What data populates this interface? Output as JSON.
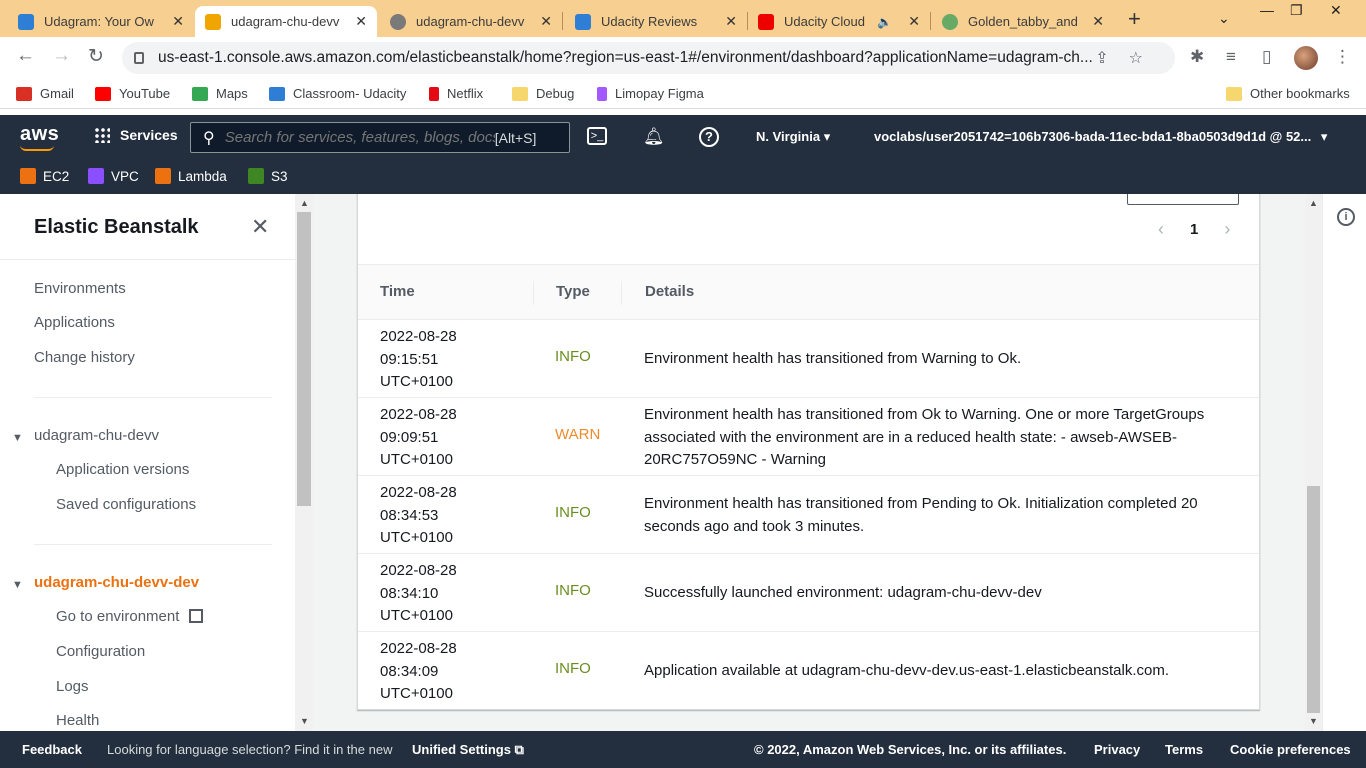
{
  "browser": {
    "tabs": [
      {
        "title": "Udagram: Your Ow",
        "color": "#2e7ed6",
        "active": false
      },
      {
        "title": "udagram-chu-devv",
        "color": "#f0a500",
        "active": true
      },
      {
        "title": "udagram-chu-devv",
        "color": "#7a7a7a",
        "active": false
      },
      {
        "title": "Udacity Reviews",
        "color": "#2e7ed6",
        "active": false
      },
      {
        "title": "Udacity Cloud",
        "color": "#e00",
        "active": false
      },
      {
        "title": "Golden_tabby_and",
        "color": "#6a6",
        "active": false
      }
    ],
    "url": "us-east-1.console.aws.amazon.com/elasticbeanstalk/home?region=us-east-1#/environment/dashboard?applicationName=udagram-ch...",
    "bookmarks": [
      {
        "label": "Gmail",
        "color": "#d93025"
      },
      {
        "label": "YouTube",
        "color": "#ff0000"
      },
      {
        "label": "Maps",
        "color": "#34a853"
      },
      {
        "label": "Classroom- Udacity",
        "color": "#2e7ed6"
      },
      {
        "label": "Netflix",
        "color": "#e50914"
      },
      {
        "label": "Debug",
        "color": "#f5d76e"
      },
      {
        "label": "Limopay Figma",
        "color": "#a259ff"
      }
    ],
    "other_bookmarks": "Other bookmarks"
  },
  "aws": {
    "logo": "aws",
    "services": "Services",
    "search_placeholder": "Search for services, features, blogs, docs, and more",
    "search_shortcut": "[Alt+S]",
    "region": "N. Virginia",
    "account": "voclabs/user2051742=106b7306-bada-11ec-bda1-8ba0503d9d1d @ 52...",
    "favorites": [
      {
        "label": "EC2",
        "color": "#ec7211"
      },
      {
        "label": "VPC",
        "color": "#8c4fff"
      },
      {
        "label": "Lambda",
        "color": "#ec7211"
      },
      {
        "label": "S3",
        "color": "#3f8624"
      }
    ]
  },
  "sidebar": {
    "title": "Elastic Beanstalk",
    "top_links": [
      "Environments",
      "Applications",
      "Change history"
    ],
    "app_name": "udagram-chu-devv",
    "app_links": [
      "Application versions",
      "Saved configurations"
    ],
    "env_name": "udagram-chu-devv-dev",
    "env_links": [
      "Go to environment",
      "Configuration",
      "Logs",
      "Health"
    ]
  },
  "events": {
    "page": "1",
    "columns": [
      "Time",
      "Type",
      "Details"
    ],
    "rows": [
      {
        "date": "2022-08-28",
        "time": "09:15:51",
        "tz": "UTC+0100",
        "type": "INFO",
        "details": "Environment health has transitioned from Warning to Ok."
      },
      {
        "date": "2022-08-28",
        "time": "09:09:51",
        "tz": "UTC+0100",
        "type": "WARN",
        "details": "Environment health has transitioned from Ok to Warning. One or more TargetGroups associated with the environment are in a reduced health state: - awseb-AWSEB-20RC757O59NC - Warning"
      },
      {
        "date": "2022-08-28",
        "time": "08:34:53",
        "tz": "UTC+0100",
        "type": "INFO",
        "details": "Environment health has transitioned from Pending to Ok. Initialization completed 20 seconds ago and took 3 minutes."
      },
      {
        "date": "2022-08-28",
        "time": "08:34:10",
        "tz": "UTC+0100",
        "type": "INFO",
        "details": "Successfully launched environment: udagram-chu-devv-dev"
      },
      {
        "date": "2022-08-28",
        "time": "08:34:09",
        "tz": "UTC+0100",
        "type": "INFO",
        "details": "Application available at udagram-chu-devv-dev.us-east-1.elasticbeanstalk.com."
      }
    ]
  },
  "footer": {
    "feedback": "Feedback",
    "language_text": "Looking for language selection? Find it in the new",
    "unified_settings": "Unified Settings",
    "copyright": "© 2022, Amazon Web Services, Inc. or its affiliates.",
    "privacy": "Privacy",
    "terms": "Terms",
    "cookies": "Cookie preferences"
  },
  "colors": {
    "info": "#6a8e21",
    "warn": "#eb8c2e",
    "active_env": "#ec7211",
    "aws_header": "#232f3e"
  }
}
